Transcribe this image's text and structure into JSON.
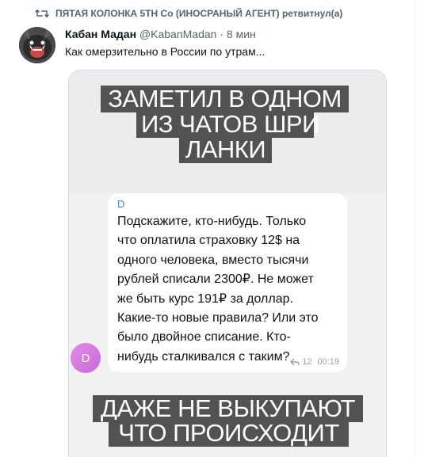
{
  "retweet": {
    "text": "ПЯТАЯ КОЛОНКА 5TH Co (ИНОСРАНЫЙ АГЕНТ) ретвитнул(а)"
  },
  "tweet": {
    "author_name": "Кабан Мадан",
    "handle": "@KabanMadan",
    "separator": "·",
    "time": "8 мин",
    "text": "Как омерзительно в России по утрам..."
  },
  "media": {
    "captions": [
      "ЗАМЕТИЛ В ОДНОМ",
      "ИЗ ЧАТОВ ШРИ",
      "ЛАНКИ",
      "ДАЖЕ НЕ ВЫКУПАЮТ",
      "ЧТО ПРОИСХОДИТ"
    ],
    "chat": {
      "sender": "D",
      "avatar_letter": "D",
      "message_lines": [
        "Подскажите, кто-нибудь. Только",
        "что оплатила страховку 12$ на",
        "одного человека, вместо тысячи",
        "рублей списали 2300₽. Не может",
        "же быть курс 191₽ за доллар.",
        "Какие-то новые правила? Или это",
        "было двойное списание. Кто-",
        "нибудь сталкивался с таким?"
      ],
      "reply_count": "12",
      "time": "00:19"
    }
  },
  "colors": {
    "caption_bg": "#525252",
    "sender_blue": "#3b8ad9",
    "avatar_pink": "#d77ae0"
  }
}
